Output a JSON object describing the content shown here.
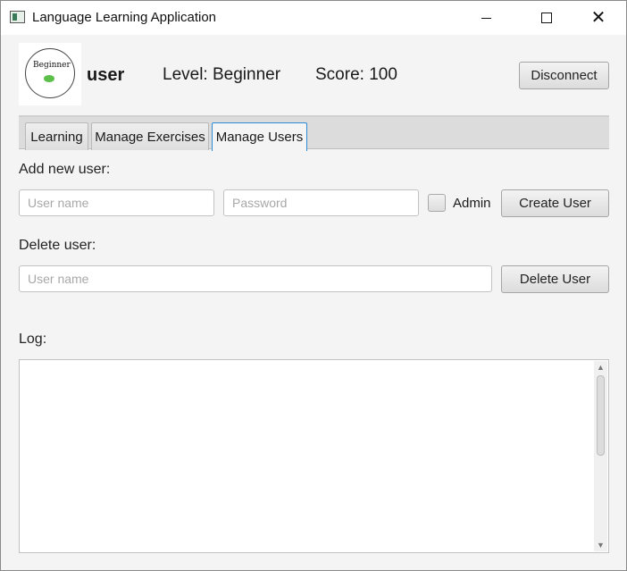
{
  "window": {
    "title": "Language Learning Application"
  },
  "header": {
    "logo_text": "Beginner",
    "username": "user",
    "level": "Level: Beginner",
    "score": "Score: 100",
    "disconnect_label": "Disconnect"
  },
  "tabs": [
    {
      "label": "Learning",
      "selected": false
    },
    {
      "label": "Manage Exercises",
      "selected": false
    },
    {
      "label": "Manage Users",
      "selected": true
    }
  ],
  "add_user": {
    "heading": "Add new user:",
    "username_placeholder": "User name",
    "username_value": "",
    "password_placeholder": "Password",
    "password_value": "",
    "admin_label": "Admin",
    "admin_checked": false,
    "create_label": "Create User"
  },
  "delete_user": {
    "heading": "Delete user:",
    "username_placeholder": "User name",
    "username_value": "",
    "delete_label": "Delete User"
  },
  "log": {
    "heading": "Log:",
    "content": ""
  },
  "colors": {
    "accent": "#2e8bd6",
    "background": "#f4f4f4"
  }
}
